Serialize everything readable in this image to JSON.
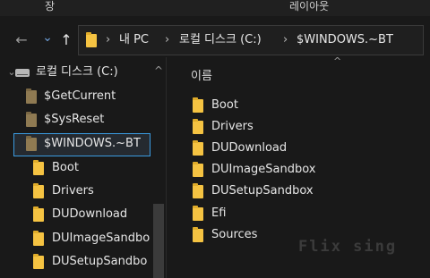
{
  "ribbon": {
    "left_label": "장",
    "right_label": "레이아웃"
  },
  "nav": {
    "back": "←",
    "forward": "→",
    "recent": "⌄",
    "up": "↑"
  },
  "address": {
    "crumbs": [
      "내 PC",
      "로컬 디스크 (C:)",
      "$WINDOWS.~BT"
    ],
    "separator": "›"
  },
  "sidebar": {
    "drive_label": "로컬 디스크 (C:)",
    "expand_chevron": "^",
    "items": [
      {
        "label": "$GetCurrent"
      },
      {
        "label": "$SysReset"
      },
      {
        "label": "$WINDOWS.~BT",
        "selected": true
      },
      {
        "label": "Boot"
      },
      {
        "label": "Drivers"
      },
      {
        "label": "DUDownload"
      },
      {
        "label": "DUImageSandbo"
      },
      {
        "label": "DUSetupSandbo"
      }
    ]
  },
  "content": {
    "column_header": "이름",
    "sort_indicator": "^",
    "items": [
      {
        "label": "Boot"
      },
      {
        "label": "Drivers"
      },
      {
        "label": "DUDownload"
      },
      {
        "label": "DUImageSandbox"
      },
      {
        "label": "DUSetupSandbox"
      },
      {
        "label": "Efi"
      },
      {
        "label": "Sources"
      }
    ]
  },
  "watermark": "Flix sing"
}
